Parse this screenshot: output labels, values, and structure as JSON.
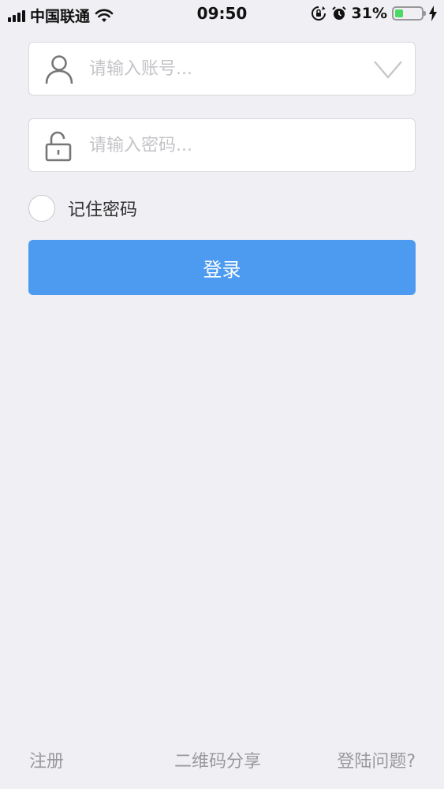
{
  "status_bar": {
    "carrier": "中国联通",
    "time": "09:50",
    "battery_percent": "31%",
    "battery_level": 0.31,
    "icons": [
      "signal-icon",
      "wifi-icon",
      "screen-lock-rotation-icon",
      "alarm-icon",
      "battery-icon",
      "charging-icon"
    ]
  },
  "login_form": {
    "account_placeholder": "请输入账号...",
    "password_placeholder": "请输入密码...",
    "remember_label": "记住密码",
    "login_button": "登录",
    "icons": [
      "user-icon",
      "dropdown-chevron-icon",
      "lock-icon"
    ]
  },
  "footer": {
    "register": "注册",
    "qr_share": "二维码分享",
    "login_issue": "登陆问题?"
  },
  "colors": {
    "background": "#efeff4",
    "primary": "#4d9bf0",
    "battery_green": "#4cd964"
  }
}
